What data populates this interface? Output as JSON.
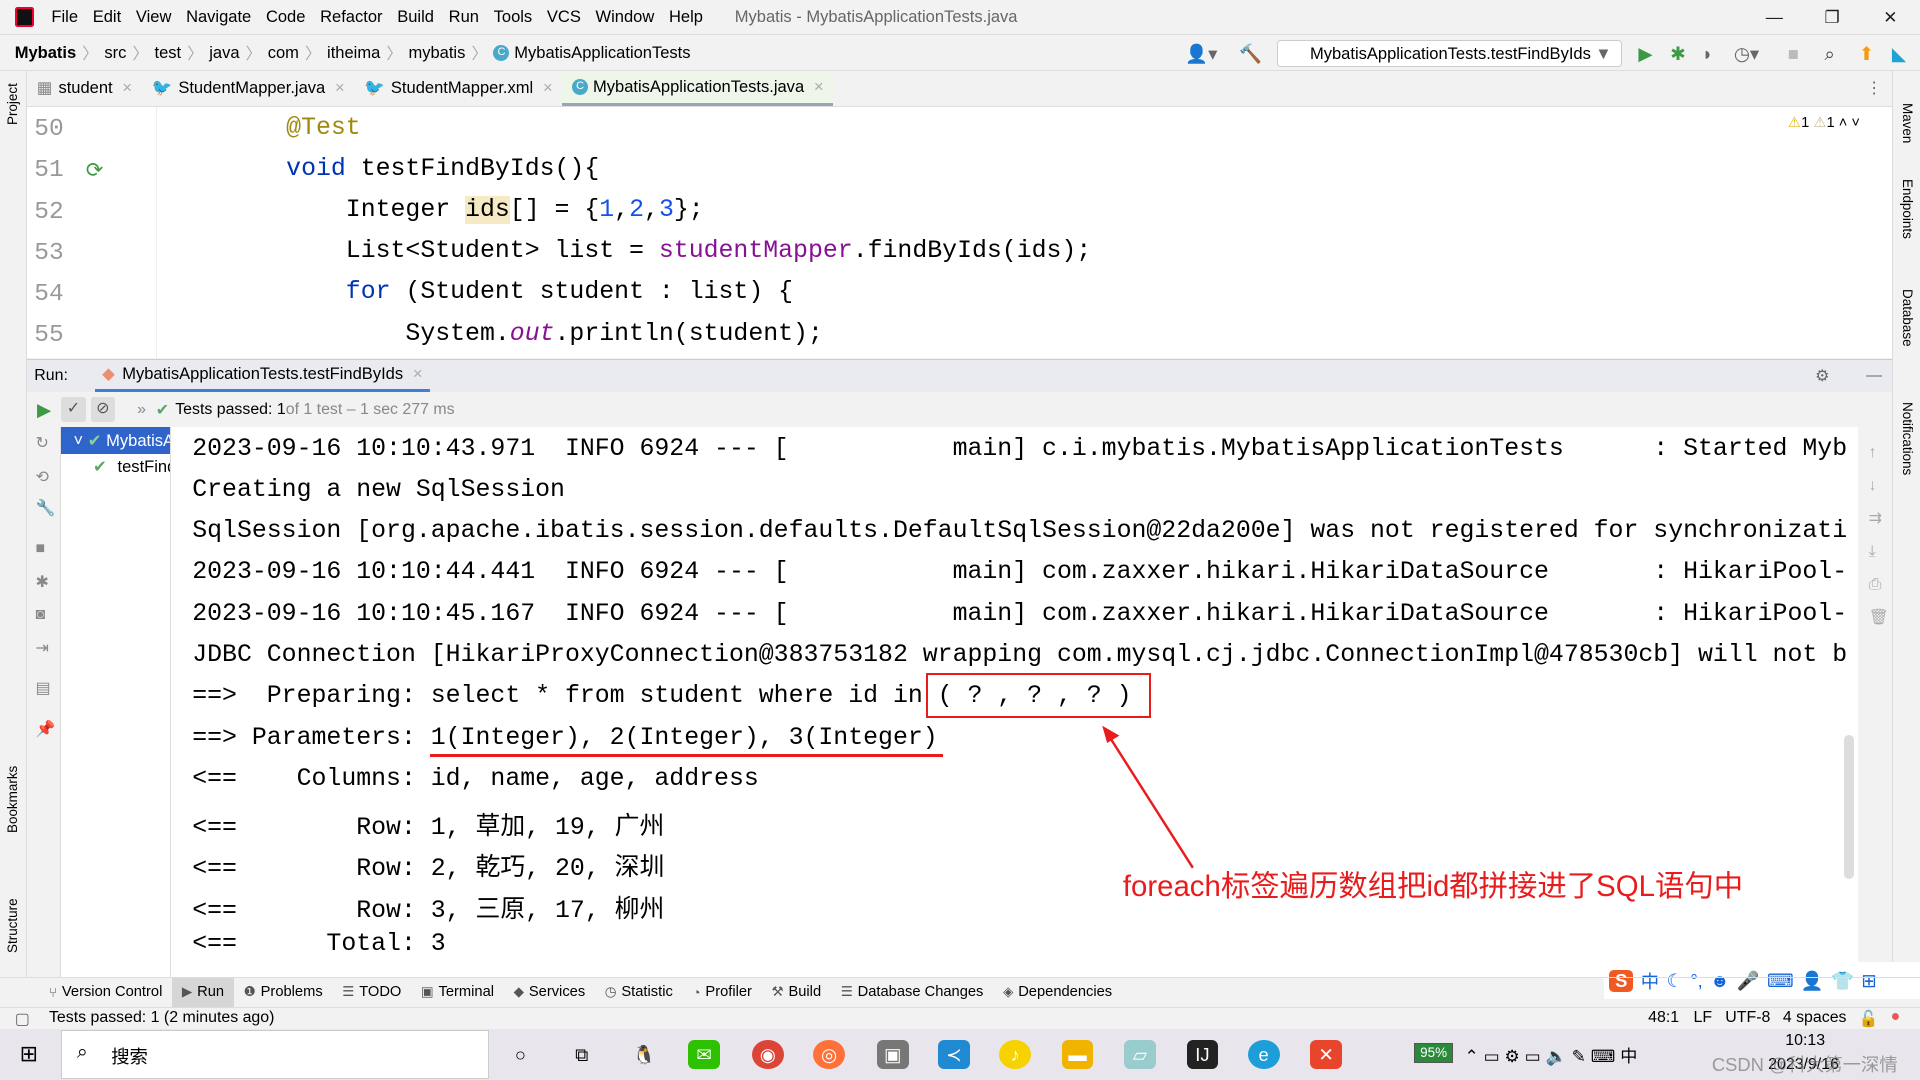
{
  "window": {
    "title": "Mybatis - MybatisApplicationTests.java"
  },
  "menu": [
    "File",
    "Edit",
    "View",
    "Navigate",
    "Code",
    "Refactor",
    "Build",
    "Run",
    "Tools",
    "VCS",
    "Window",
    "Help"
  ],
  "breadcrumb": [
    "Mybatis",
    "src",
    "test",
    "java",
    "com",
    "itheima",
    "mybatis",
    "MybatisApplicationTests"
  ],
  "toolbar": {
    "run_config": "MybatisApplicationTests.testFindByIds"
  },
  "left_strip": {
    "project": "Project",
    "bookmarks": "Bookmarks",
    "structure": "Structure"
  },
  "right_strip": {
    "maven": "Maven",
    "endpoints": "Endpoints",
    "database": "Database",
    "notifications": "Notifications"
  },
  "tabs": [
    {
      "label": "student",
      "active": false
    },
    {
      "label": "StudentMapper.java",
      "active": false
    },
    {
      "label": "StudentMapper.xml",
      "active": false
    },
    {
      "label": "MybatisApplicationTests.java",
      "active": true
    }
  ],
  "inspections": {
    "warnings": "1",
    "weak_warnings": "1"
  },
  "editor": {
    "line_numbers": [
      "50",
      "51",
      "52",
      "53",
      "54",
      "55"
    ],
    "lines": [
      [
        {
          "t": "    "
        },
        {
          "t": "@Test",
          "c": "an"
        }
      ],
      [
        {
          "t": "    "
        },
        {
          "t": "void ",
          "c": "kw"
        },
        {
          "t": "testFindByIds(){"
        }
      ],
      [
        {
          "t": "        Integer "
        },
        {
          "t": "ids",
          "c": "hl"
        },
        {
          "t": "[] = {"
        },
        {
          "t": "1",
          "c": "num"
        },
        {
          "t": ","
        },
        {
          "t": "2",
          "c": "num"
        },
        {
          "t": ","
        },
        {
          "t": "3",
          "c": "num"
        },
        {
          "t": "};"
        }
      ],
      [
        {
          "t": "        List<Student> list = "
        },
        {
          "t": "studentMapper",
          "c": "fld"
        },
        {
          "t": ".findByIds(ids);"
        }
      ],
      [
        {
          "t": "        "
        },
        {
          "t": "for ",
          "c": "kw"
        },
        {
          "t": "(Student student : list) {"
        }
      ],
      [
        {
          "t": "            System."
        },
        {
          "t": "out",
          "c": "it"
        },
        {
          "t": ".println(student);"
        }
      ]
    ]
  },
  "run": {
    "label": "Run:",
    "tab": "MybatisApplicationTests.testFindByIds",
    "status_bold": "Tests passed: 1",
    "status_rest": " of 1 test – 1 sec 277 ms",
    "tree": {
      "root": "MybatisApplicationTests",
      "child": "testFindByIds"
    },
    "console": [
      "2023-09-16 10:10:43.971  INFO 6924 --- [           main] c.i.mybatis.MybatisApplicationTests      : Started Myb",
      "Creating a new SqlSession",
      "SqlSession [org.apache.ibatis.session.defaults.DefaultSqlSession@22da200e] was not registered for synchronizati",
      "2023-09-16 10:10:44.441  INFO 6924 --- [           main] com.zaxxer.hikari.HikariDataSource       : HikariPool-",
      "2023-09-16 10:10:45.167  INFO 6924 --- [           main] com.zaxxer.hikari.HikariDataSource       : HikariPool-",
      "JDBC Connection [HikariProxyConnection@383753182 wrapping com.mysql.cj.jdbc.ConnectionImpl@478530cb] will not b",
      "==>  Preparing: select * from student where id in ( ? , ? , ? )",
      "==> Parameters: 1(Integer), 2(Integer), 3(Integer)",
      "<==    Columns: id, name, age, address",
      "<==        Row: 1, 草加, 19, 广州",
      "<==        Row: 2, 乾巧, 20, 深圳",
      "<==        Row: 3, 三原, 17, 柳州",
      "<==      Total: 3"
    ],
    "annotation": "foreach标签遍历数组把id都拼接进了SQL语句中"
  },
  "tool_windows": [
    "Version Control",
    "Run",
    "Problems",
    "TODO",
    "Terminal",
    "Services",
    "Statistic",
    "Profiler",
    "Build",
    "Database Changes",
    "Dependencies"
  ],
  "status": {
    "message": "Tests passed: 1 (2 minutes ago)",
    "position": "48:1",
    "line_sep": "LF",
    "encoding": "UTF-8",
    "indent": "4 spaces"
  },
  "taskbar": {
    "search": "搜索",
    "battery": "95%",
    "time": "10:13",
    "date": "2023/9/16",
    "ime": "中",
    "watermark": "CSDN @科大第一深情"
  },
  "colors": {
    "accent": "#2f65ca",
    "annotation": "#e81c1c",
    "pass": "#59a869"
  }
}
